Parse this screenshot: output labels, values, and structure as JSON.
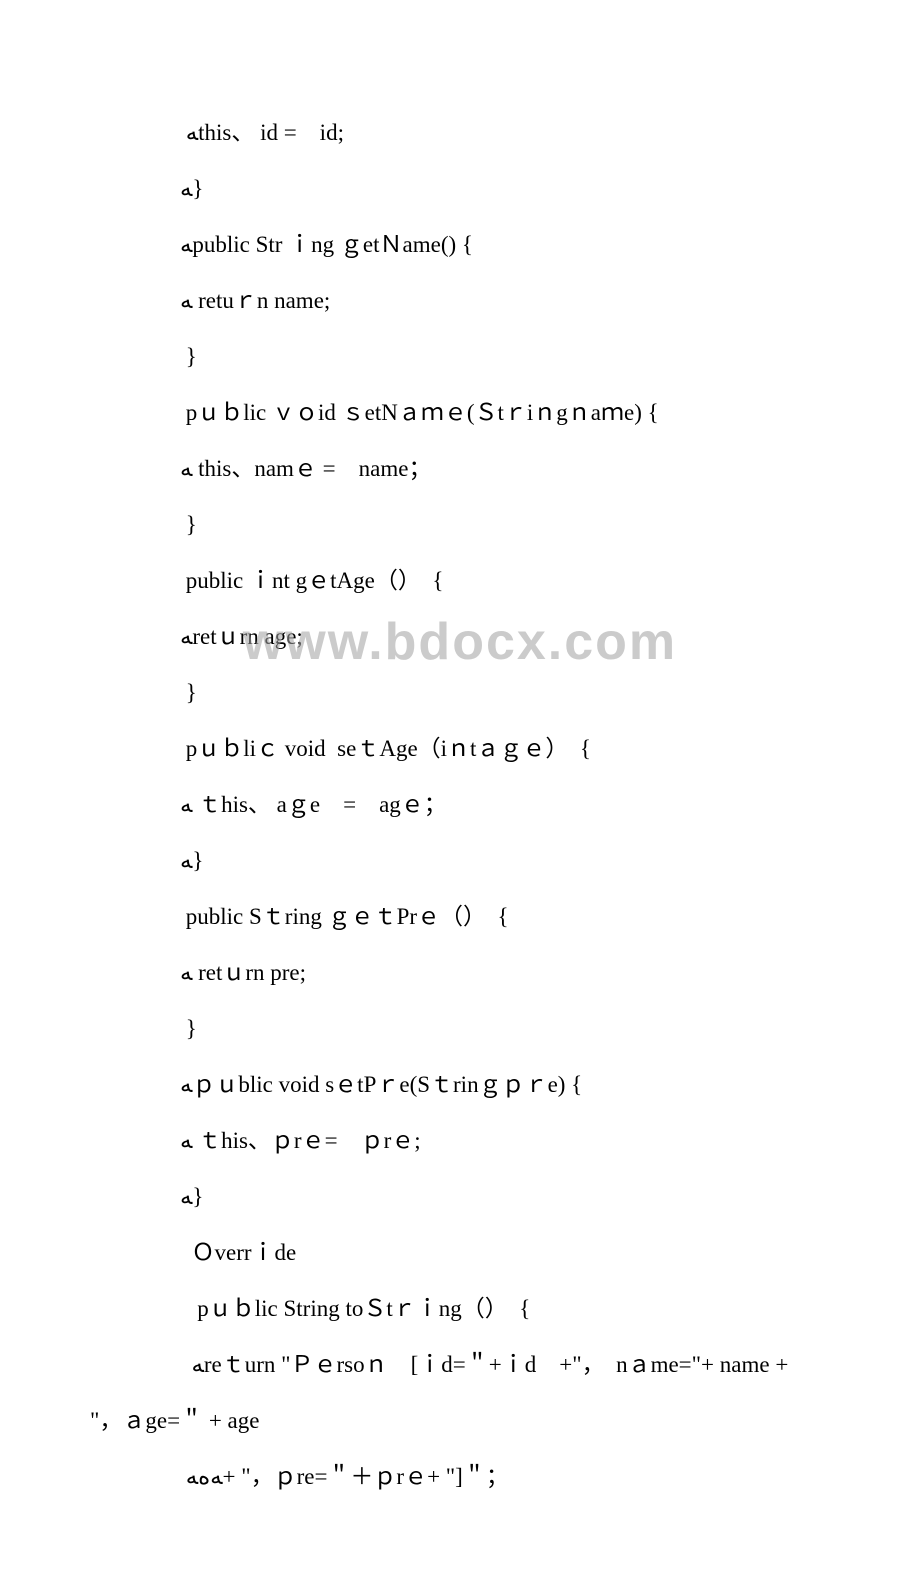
{
  "watermark": "www.bdocx.com",
  "code": {
    "l01": " ﻪthis、 id =　id;",
    "l02": "ﻪ}",
    "l03": "ﻪpublic Str ｉng ｇetＮame() {",
    "l04": "ﻪ retuｒn name;",
    "l05": " }",
    "l06": " pｕｂlic ｖｏid ｓetNａｍｅ(Ｓtｒiｎgｎaｍe) {",
    "l07": "ﻪ this、namｅ =　name；",
    "l08": " }",
    "l09": " public ｉnt gｅtAge（）　{",
    "l10": "ﻪretｕrn age;",
    "l11": " }",
    "l12": " pｕｂliｃ void  seｔAge（iｎtａｇｅ）　{",
    "l13": "ﻪ ｔhis、 aｇe　=　agｅ；",
    "l14": "ﻪ}",
    "l15": " public Sｔring ｇｅｔPrｅ（）　{",
    "l16": "ﻪ retｕrn pre;",
    "l17": " }",
    "l18": "ﻪｐｕblic void sｅtPｒe(Sｔrinｇｐｒe) {",
    "l19": "ﻪ ｔhis、ｐrｅ=　ｐrｅ;",
    "l20": "ﻪ}",
    "l21": "  Ｏverrｉde",
    "l22": "   pｕｂlic String toＳtｒｉng（）　{",
    "l23a": "  ﻪreｔurn \"Ｐｅrsoｎ　[ｉd=＂+ｉd　+\"，　nａme=\"+ name +",
    "l23b": "\"，ａge=＂ + age",
    "l24": " ﻪﻩﻪ+ \"，ｐre=＂＋ｐrｅ+ \"]＂；"
  }
}
